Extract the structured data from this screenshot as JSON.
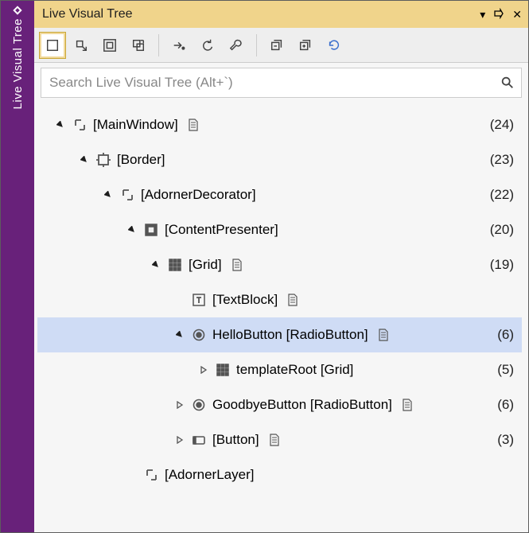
{
  "sideTab": {
    "label": "Live Visual Tree"
  },
  "titlebar": {
    "title": "Live Visual Tree",
    "menu_glyph": "▾",
    "pin_glyph": "⊣",
    "close_glyph": "✕"
  },
  "search": {
    "placeholder": "Search Live Visual Tree (Alt+`)"
  },
  "tree": {
    "rows": [
      {
        "depth": 0,
        "twisty": "expanded",
        "icon": "angle",
        "label": "[MainWindow]",
        "doc": true,
        "count": "(24)",
        "selected": false
      },
      {
        "depth": 1,
        "twisty": "expanded",
        "icon": "border",
        "label": "[Border]",
        "doc": false,
        "count": "(23)",
        "selected": false
      },
      {
        "depth": 2,
        "twisty": "expanded",
        "icon": "angle",
        "label": "[AdornerDecorator]",
        "doc": false,
        "count": "(22)",
        "selected": false
      },
      {
        "depth": 3,
        "twisty": "expanded",
        "icon": "content",
        "label": "[ContentPresenter]",
        "doc": false,
        "count": "(20)",
        "selected": false
      },
      {
        "depth": 4,
        "twisty": "expanded",
        "icon": "grid",
        "label": "[Grid]",
        "doc": true,
        "count": "(19)",
        "selected": false
      },
      {
        "depth": 5,
        "twisty": "none",
        "icon": "text",
        "label": "[TextBlock]",
        "doc": true,
        "count": "",
        "selected": false
      },
      {
        "depth": 5,
        "twisty": "expanded",
        "icon": "radio",
        "label": "HelloButton [RadioButton]",
        "doc": true,
        "count": "(6)",
        "selected": true
      },
      {
        "depth": 6,
        "twisty": "collapsed",
        "icon": "grid",
        "label": "templateRoot [Grid]",
        "doc": false,
        "count": "(5)",
        "selected": false
      },
      {
        "depth": 5,
        "twisty": "collapsed",
        "icon": "radio",
        "label": "GoodbyeButton [RadioButton]",
        "doc": true,
        "count": "(6)",
        "selected": false
      },
      {
        "depth": 5,
        "twisty": "collapsed",
        "icon": "button",
        "label": "[Button]",
        "doc": true,
        "count": "(3)",
        "selected": false
      },
      {
        "depth": 3,
        "twisty": "none",
        "icon": "angle",
        "label": "[AdornerLayer]",
        "doc": false,
        "count": "",
        "selected": false
      }
    ]
  }
}
